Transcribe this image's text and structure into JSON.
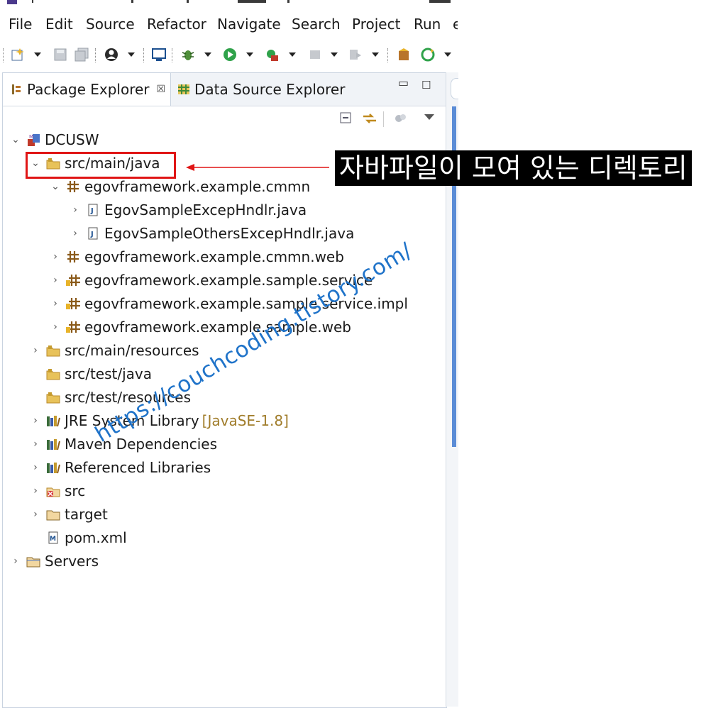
{
  "menu": {
    "items": [
      "File",
      "Edit",
      "Source",
      "Refactor",
      "Navigate",
      "Search",
      "Project",
      "Run"
    ]
  },
  "toolbar": {
    "icons": [
      "new-wizard-icon",
      "save-icon",
      "save-all-icon",
      "account-icon",
      "terminal-icon",
      "debug-icon",
      "run-icon",
      "external-tools-icon",
      "stop-icon",
      "skip-icon",
      "package-icon",
      "refresh-icon"
    ]
  },
  "tabs": {
    "package_explorer": "Package Explorer",
    "close_glyph": "☒",
    "data_source_explorer": "Data Source Explorer"
  },
  "tree": {
    "project": "DCUSW",
    "src_main_java": "src/main/java",
    "pkg_cmmn": "egovframework.example.cmmn",
    "file_1": "EgovSampleExcepHndlr.java",
    "file_2": "EgovSampleOthersExcepHndlr.java",
    "pkg_cmmn_web": "egovframework.example.cmmn.web",
    "pkg_sample_service": "egovframework.example.sample.service",
    "pkg_sample_service_impl": "egovframework.example.sample.service.impl",
    "pkg_sample_web": "egovframework.example.sample.web",
    "src_main_resources": "src/main/resources",
    "src_test_java": "src/test/java",
    "src_test_resources": "src/test/resources",
    "jre": "JRE System Library",
    "jre_decoration": "[JavaSE-1.8]",
    "maven": "Maven Dependencies",
    "referenced": "Referenced Libraries",
    "src": "src",
    "target": "target",
    "pom": "pom.xml",
    "servers": "Servers"
  },
  "annotation": {
    "callout_text": "자바파일이 모여 있는 디렉토리",
    "highlight_color": "#e01515"
  },
  "watermark": "https://couchcoding.tistory.com/"
}
